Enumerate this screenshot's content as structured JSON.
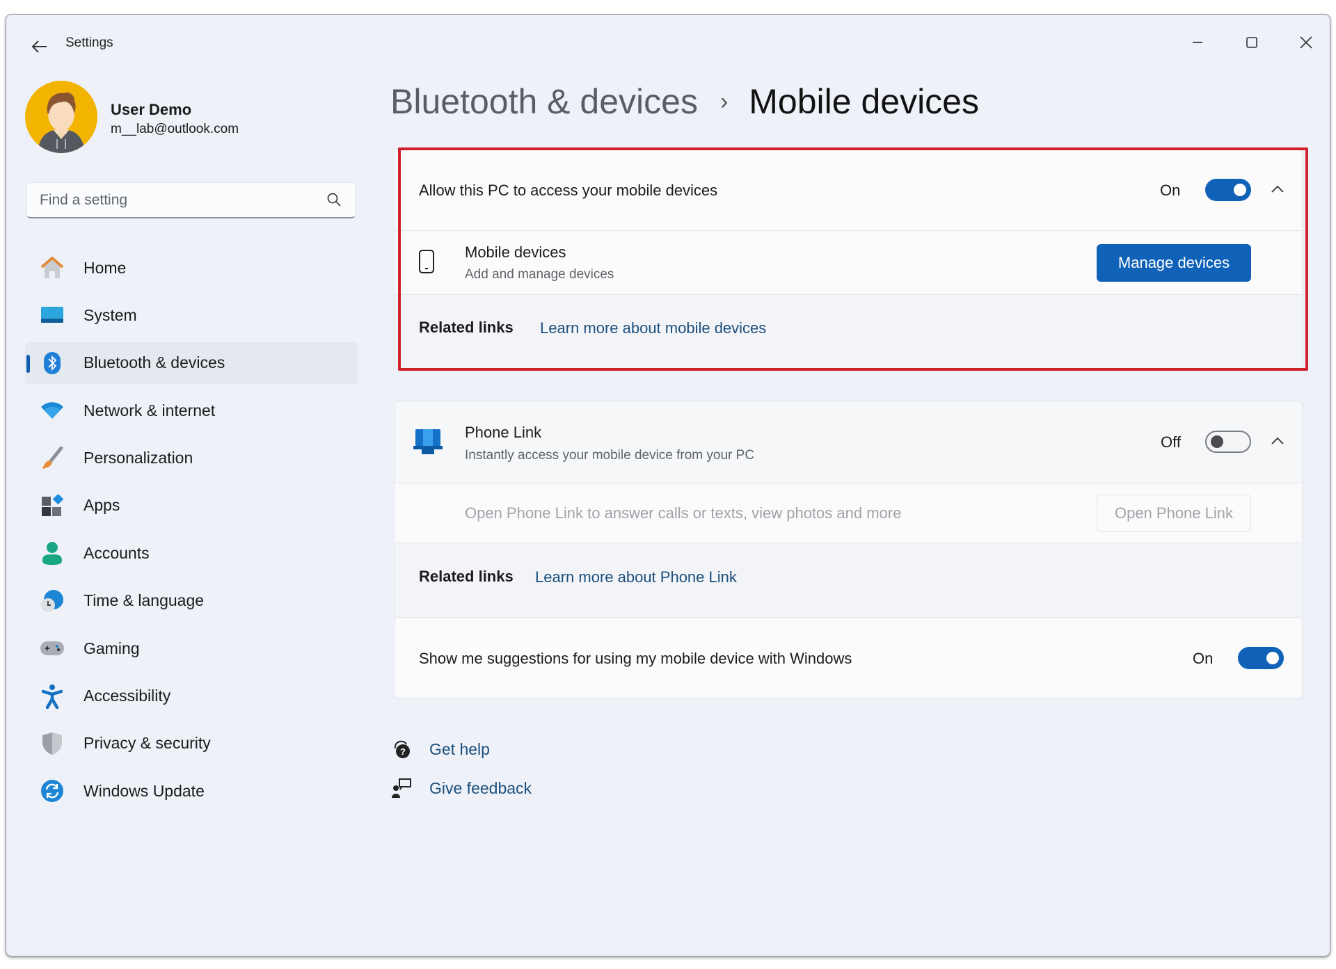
{
  "window": {
    "title": "Settings",
    "controls": {
      "minimize": "minimize-icon",
      "maximize": "maximize-icon",
      "close": "close-icon"
    }
  },
  "profile": {
    "name": "User Demo",
    "email": "m__lab@outlook.com"
  },
  "search": {
    "placeholder": "Find a setting",
    "value": ""
  },
  "sidebar": {
    "active_index": 2,
    "items": [
      {
        "label": "Home",
        "icon": "home-icon"
      },
      {
        "label": "System",
        "icon": "system-icon"
      },
      {
        "label": "Bluetooth & devices",
        "icon": "bluetooth-icon"
      },
      {
        "label": "Network & internet",
        "icon": "wifi-icon"
      },
      {
        "label": "Personalization",
        "icon": "brush-icon"
      },
      {
        "label": "Apps",
        "icon": "apps-icon"
      },
      {
        "label": "Accounts",
        "icon": "person-icon"
      },
      {
        "label": "Time & language",
        "icon": "globe-clock-icon"
      },
      {
        "label": "Gaming",
        "icon": "gamepad-icon"
      },
      {
        "label": "Accessibility",
        "icon": "accessibility-icon"
      },
      {
        "label": "Privacy & security",
        "icon": "shield-icon"
      },
      {
        "label": "Windows Update",
        "icon": "update-icon"
      }
    ]
  },
  "breadcrumb": {
    "parent": "Bluetooth & devices",
    "separator": "›",
    "current": "Mobile devices"
  },
  "mobile_access": {
    "title": "Allow this PC to access your mobile devices",
    "state_label": "On",
    "enabled": true,
    "expanded": true,
    "devices_row": {
      "title": "Mobile devices",
      "subtitle": "Add and manage devices",
      "button": "Manage devices"
    },
    "related_links_label": "Related links",
    "related_link": "Learn more about mobile devices",
    "highlighted": true
  },
  "phone_link": {
    "title": "Phone Link",
    "subtitle": "Instantly access your mobile device from your PC",
    "state_label": "Off",
    "enabled": false,
    "expanded": true,
    "open_row_text": "Open Phone Link to answer calls or texts, view photos and more",
    "open_button": "Open Phone Link",
    "related_links_label": "Related links",
    "related_link": "Learn more about Phone Link"
  },
  "suggestions": {
    "title": "Show me suggestions for using my mobile device with Windows",
    "state_label": "On",
    "enabled": true
  },
  "footer": {
    "get_help": "Get help",
    "give_feedback": "Give feedback"
  },
  "colors": {
    "accent": "#0f62b8",
    "highlight_box": "#d0202c",
    "link": "#1d4f7c",
    "window_bg": "#eef2f8"
  }
}
